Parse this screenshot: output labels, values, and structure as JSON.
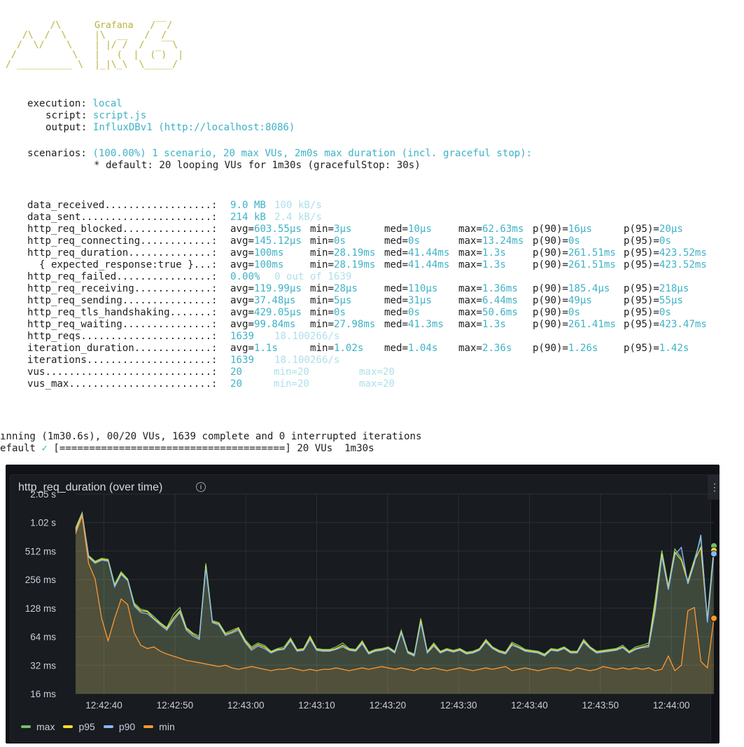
{
  "terminal": {
    "logo_brand": "Grafana",
    "execution": {
      "label": "execution:",
      "value": "local"
    },
    "script": {
      "label": "script:",
      "value": "script.js"
    },
    "output": {
      "label": "output:",
      "value": "InfluxDBv1 (http://localhost:8086)"
    },
    "scenarios": {
      "label": "scenarios:",
      "value": "(100.00%) 1 scenario, 20 max VUs, 2m0s max duration (incl. graceful stop):"
    },
    "scenario_default": "* default: 20 looping VUs for 1m30s (gracefulStop: 30s)",
    "metrics": [
      {
        "name": "data_received",
        "dots": "..................:",
        "cols": [
          "9.0 MB",
          "100 kB/s"
        ]
      },
      {
        "name": "data_sent",
        "dots": "......................:",
        "cols": [
          "214 kB",
          "2.4 kB/s"
        ]
      },
      {
        "name": "http_req_blocked",
        "dots": "...............:",
        "cols": [
          "avg=603.55µs",
          "min=3µs",
          "med=10µs",
          "max=62.63ms",
          "p(90)=16µs",
          "p(95)=20µs"
        ]
      },
      {
        "name": "http_req_connecting",
        "dots": "............:",
        "cols": [
          "avg=145.12µs",
          "min=0s",
          "med=0s",
          "max=13.24ms",
          "p(90)=0s",
          "p(95)=0s"
        ]
      },
      {
        "name": "http_req_duration",
        "dots": "..............:",
        "cols": [
          "avg=100ms",
          "min=28.19ms",
          "med=41.44ms",
          "max=1.3s",
          "p(90)=261.51ms",
          "p(95)=423.52ms"
        ]
      },
      {
        "name": "  { expected_response:true }",
        "dots": "...:",
        "cols": [
          "avg=100ms",
          "min=28.19ms",
          "med=41.44ms",
          "max=1.3s",
          "p(90)=261.51ms",
          "p(95)=423.52ms"
        ]
      },
      {
        "name": "http_req_failed",
        "dots": "................:",
        "cols": [
          "0.00%",
          "0 out of 1639"
        ]
      },
      {
        "name": "http_req_receiving",
        "dots": ".............:",
        "cols": [
          "avg=119.99µs",
          "min=28µs",
          "med=110µs",
          "max=1.36ms",
          "p(90)=185.4µs",
          "p(95)=218µs"
        ]
      },
      {
        "name": "http_req_sending",
        "dots": "...............:",
        "cols": [
          "avg=37.48µs",
          "min=5µs",
          "med=31µs",
          "max=6.44ms",
          "p(90)=49µs",
          "p(95)=55µs"
        ]
      },
      {
        "name": "http_req_tls_handshaking",
        "dots": ".......:",
        "cols": [
          "avg=429.05µs",
          "min=0s",
          "med=0s",
          "max=50.6ms",
          "p(90)=0s",
          "p(95)=0s"
        ]
      },
      {
        "name": "http_req_waiting",
        "dots": "...............:",
        "cols": [
          "avg=99.84ms",
          "min=27.98ms",
          "med=41.3ms",
          "max=1.3s",
          "p(90)=261.41ms",
          "p(95)=423.47ms"
        ]
      },
      {
        "name": "http_reqs",
        "dots": "......................:",
        "cols": [
          "1639",
          "18.100266/s"
        ]
      },
      {
        "name": "iteration_duration",
        "dots": ".............:",
        "cols": [
          "avg=1.1s",
          "min=1.02s",
          "med=1.04s",
          "max=2.36s",
          "p(90)=1.26s",
          "p(95)=1.42s"
        ]
      },
      {
        "name": "iterations",
        "dots": ".....................:",
        "cols": [
          "1639",
          "18.100266/s"
        ]
      },
      {
        "name": "vus",
        "dots": "............................:",
        "cols": [
          "20",
          "min=20",
          "max=20"
        ]
      },
      {
        "name": "vus_max",
        "dots": "........................:",
        "cols": [
          "20",
          "min=20",
          "max=20"
        ]
      }
    ],
    "running_line": "ınning (1m30.6s), 00/20 VUs, 1639 complete and 0 interrupted iterations",
    "default_prefix": "efault",
    "default_check": "✓",
    "progress_bar": "[======================================]",
    "default_suffix": " 20 VUs  1m30s"
  },
  "panel": {
    "title": "http_req_duration (over time)",
    "info_icon": "info-icon",
    "menu_icon": "kebab-menu-icon"
  },
  "chart_data": {
    "type": "line",
    "title": "http_req_duration (over time)",
    "y_scale": "log2",
    "y_ticks": [
      "2.05 s",
      "1.02 s",
      "512 ms",
      "256 ms",
      "128 ms",
      "64 ms",
      "32 ms",
      "16 ms"
    ],
    "y_tick_values_ms": [
      2048,
      1024,
      512,
      256,
      128,
      64,
      32,
      16
    ],
    "ylim_ms": [
      16,
      2048
    ],
    "x_ticks": [
      "12:42:40",
      "12:42:50",
      "12:43:00",
      "12:43:10",
      "12:43:20",
      "12:43:30",
      "12:43:40",
      "12:43:50",
      "12:44:00"
    ],
    "x_start": "12:42:36",
    "x_end": "12:44:06",
    "grid": true,
    "legend_placement": "bottom-left",
    "series": [
      {
        "name": "max",
        "color": "#73bf69",
        "values": [
          900,
          1300,
          460,
          400,
          430,
          420,
          230,
          310,
          260,
          145,
          125,
          120,
          105,
          90,
          80,
          110,
          130,
          80,
          70,
          65,
          380,
          95,
          90,
          70,
          75,
          80,
          60,
          50,
          55,
          52,
          45,
          48,
          50,
          62,
          47,
          48,
          65,
          48,
          47,
          47,
          50,
          55,
          48,
          47,
          58,
          44,
          47,
          48,
          50,
          45,
          75,
          45,
          42,
          100,
          45,
          55,
          45,
          48,
          46,
          48,
          44,
          45,
          48,
          60,
          50,
          46,
          44,
          56,
          52,
          47,
          46,
          45,
          42,
          48,
          47,
          50,
          45,
          45,
          60,
          50,
          45,
          46,
          47,
          48,
          52,
          45,
          50,
          52,
          55,
          160,
          520,
          220,
          540,
          430,
          250,
          420,
          700,
          100,
          580
        ]
      },
      {
        "name": "p95",
        "color": "#fade2a",
        "values": [
          860,
          1280,
          450,
          390,
          420,
          410,
          220,
          300,
          255,
          140,
          120,
          118,
          100,
          88,
          78,
          100,
          120,
          78,
          68,
          62,
          360,
          92,
          88,
          68,
          72,
          78,
          58,
          48,
          53,
          50,
          44,
          47,
          48,
          60,
          46,
          47,
          63,
          47,
          46,
          46,
          48,
          52,
          47,
          46,
          56,
          43,
          46,
          47,
          49,
          44,
          72,
          44,
          41,
          95,
          44,
          53,
          44,
          47,
          45,
          47,
          43,
          44,
          47,
          58,
          49,
          45,
          43,
          54,
          50,
          46,
          45,
          44,
          41,
          47,
          46,
          49,
          44,
          44,
          58,
          49,
          44,
          45,
          46,
          47,
          50,
          44,
          48,
          50,
          52,
          140,
          480,
          210,
          500,
          410,
          240,
          400,
          560,
          95,
          520
        ]
      },
      {
        "name": "p90",
        "color": "#8ab8ff",
        "values": [
          820,
          1250,
          440,
          380,
          410,
          400,
          215,
          290,
          250,
          135,
          115,
          112,
          98,
          85,
          75,
          95,
          115,
          75,
          65,
          60,
          340,
          90,
          85,
          66,
          70,
          75,
          56,
          46,
          51,
          48,
          43,
          46,
          47,
          58,
          45,
          46,
          60,
          46,
          45,
          45,
          47,
          50,
          46,
          45,
          54,
          42,
          45,
          46,
          48,
          43,
          70,
          43,
          40,
          90,
          43,
          51,
          43,
          46,
          44,
          46,
          42,
          43,
          46,
          56,
          48,
          44,
          42,
          52,
          49,
          45,
          44,
          43,
          40,
          46,
          45,
          48,
          43,
          43,
          56,
          48,
          43,
          44,
          45,
          46,
          49,
          43,
          47,
          49,
          50,
          120,
          450,
          200,
          470,
          560,
          230,
          380,
          760,
          90,
          480
        ]
      },
      {
        "name": "min",
        "color": "#ff9830",
        "values": [
          780,
          1200,
          380,
          260,
          100,
          58,
          100,
          160,
          140,
          70,
          52,
          48,
          50,
          45,
          42,
          40,
          38,
          36,
          35,
          34,
          33,
          32,
          31,
          32,
          30,
          29,
          30,
          31,
          30,
          29,
          28,
          29,
          29,
          30,
          29,
          28,
          29,
          28,
          29,
          29,
          30,
          29,
          28,
          29,
          30,
          29,
          30,
          31,
          30,
          29,
          30,
          29,
          28,
          30,
          29,
          30,
          29,
          28,
          29,
          30,
          29,
          28,
          29,
          30,
          29,
          30,
          31,
          28,
          29,
          30,
          29,
          28,
          29,
          30,
          30,
          29,
          28,
          30,
          29,
          28,
          29,
          31,
          30,
          29,
          30,
          29,
          30,
          29,
          30,
          28,
          29,
          40,
          28,
          32,
          120,
          130,
          35,
          30,
          100
        ]
      }
    ]
  }
}
